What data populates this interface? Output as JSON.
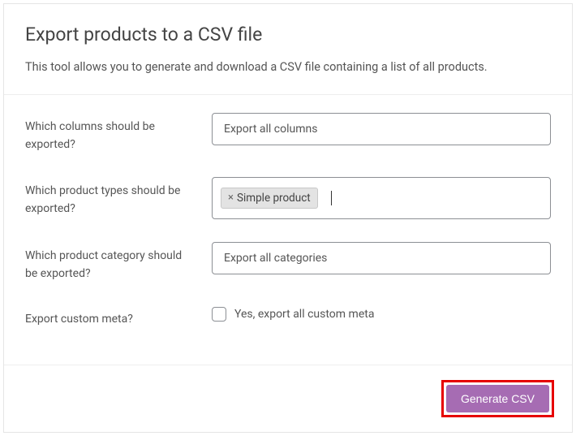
{
  "header": {
    "title": "Export products to a CSV file",
    "description": "This tool allows you to generate and download a CSV file containing a list of all products."
  },
  "form": {
    "columns": {
      "label": "Which columns should be exported?",
      "placeholder": "Export all columns"
    },
    "product_types": {
      "label": "Which product types should be exported?",
      "tags": [
        {
          "label": "Simple product"
        }
      ]
    },
    "category": {
      "label": "Which product category should be exported?",
      "placeholder": "Export all categories"
    },
    "custom_meta": {
      "label": "Export custom meta?",
      "checkbox_label": "Yes, export all custom meta",
      "checked": false
    }
  },
  "footer": {
    "button_label": "Generate CSV"
  }
}
